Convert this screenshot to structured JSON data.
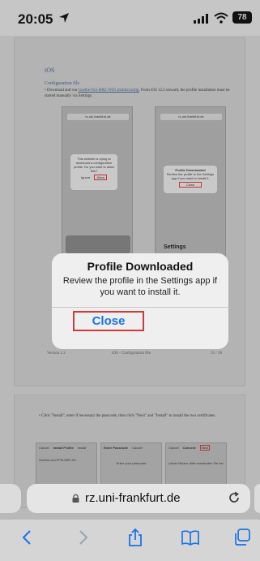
{
  "status_bar": {
    "time": "20:05",
    "battery": "78"
  },
  "document": {
    "page1": {
      "heading": "iOS",
      "section_title": "Configuration file",
      "bullet_intro": "• Download and run",
      "bullet_link": "Goethe-Uni-HRZ-WiFi.mobileconfig",
      "bullet_rest": ". From iOS 12.2 onward, the profile installation must be started manually via Settings.",
      "thumb1": {
        "url": "rz.uni-frankfurt.de",
        "alert_text": "This website is trying to download a configuration profile. Do you want to allow this?",
        "alert_ignore": "Ignore",
        "alert_allow": "Allow",
        "caption": "Figure 16 iOS Download profile"
      },
      "thumb2": {
        "url": "rz.uni-frankfurt.de",
        "alert_title": "Profile Downloaded",
        "alert_text": "Review the profile in the Settings app if you want to install it.",
        "alert_close": "Close",
        "caption": "Figure 17 iOS Profile downloaded",
        "settings": "Settings"
      },
      "footer": {
        "version": "Version 1.2",
        "center": "iOS - Configuration file",
        "page": "31 / 36"
      }
    },
    "page2": {
      "bullet": "• Click \"Install\", enter if necessary the passcode, then click \"Next\" and \"Install\" to install the two certificates.",
      "t1": {
        "cancel": "Cancel",
        "title": "Install Profile",
        "install": "Install",
        "item": "Goethe-Uni-FFM-WiFi-20..."
      },
      "t2": {
        "title": "Enter Passcode",
        "cancel": "Cancel",
        "text": "Enter your passcode"
      },
      "t3": {
        "cancel": "Cancel",
        "title": "Consent",
        "next": "Next",
        "text": "Lieber Nutzer, bitte verwenden Sie bei"
      }
    }
  },
  "modal": {
    "title": "Profile Downloaded",
    "message": "Review the profile in the Settings app if you want to install it.",
    "close_label": "Close"
  },
  "browser": {
    "url": "rz.uni-frankfurt.de"
  },
  "colors": {
    "accent": "#1a73e8",
    "highlight": "#d23a3a"
  }
}
